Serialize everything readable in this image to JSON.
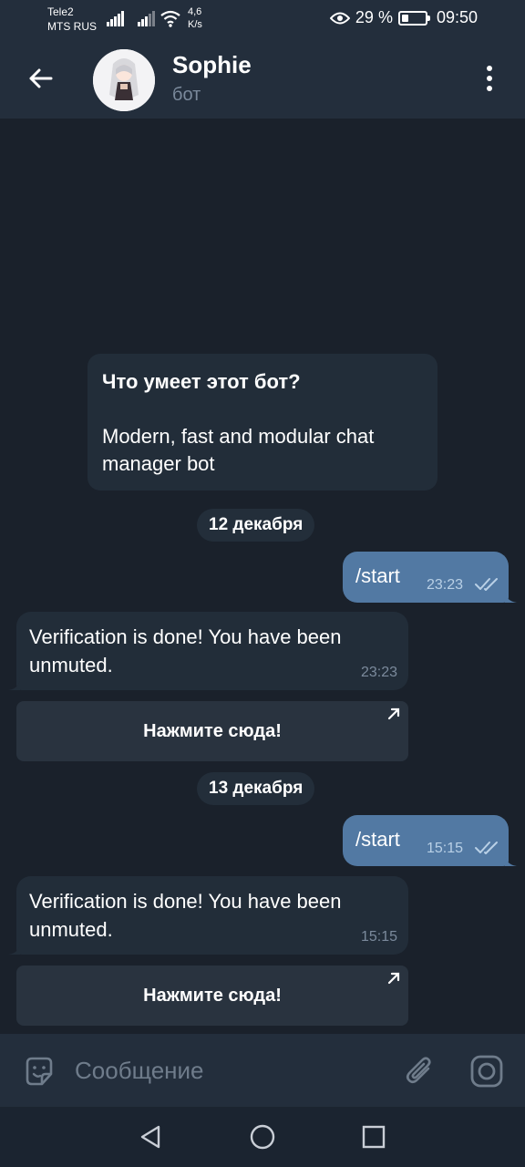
{
  "status_bar": {
    "carrier1": "Tele2",
    "carrier2": "MTS RUS",
    "net_speed_value": "4,6",
    "net_speed_unit": "K/s",
    "battery_percent": "29 %",
    "battery_level": 0.29,
    "time": "09:50",
    "icons": [
      "signal-icon",
      "signal-icon",
      "wifi-icon",
      "eye-icon",
      "battery-icon"
    ]
  },
  "header": {
    "title": "Sophie",
    "subtitle": "бот",
    "icons": [
      "back-arrow-icon",
      "more-vertical-icon"
    ]
  },
  "bot_info": {
    "title": "Что умеет этот бот?",
    "text": "Modern, fast and modular chat manager bot"
  },
  "messages": [
    {
      "type": "date",
      "text": "12 декабря"
    },
    {
      "type": "out",
      "text": "/start",
      "time": "23:23"
    },
    {
      "type": "in",
      "text": "Verification is done! You have been unmuted.",
      "time": "23:23"
    },
    {
      "type": "button",
      "text": "Нажмите сюда!"
    },
    {
      "type": "date",
      "text": "13 декабря"
    },
    {
      "type": "out",
      "text": "/start",
      "time": "15:15"
    },
    {
      "type": "in",
      "text": "Verification is done! You have been unmuted.",
      "time": "15:15"
    },
    {
      "type": "button",
      "text": "Нажмите сюда!"
    }
  ],
  "composer": {
    "placeholder": "Сообщение",
    "icons": [
      "sticker-icon",
      "attach-icon",
      "camera-icon"
    ]
  },
  "navbar": {
    "icons": [
      "nav-back-icon",
      "nav-home-icon",
      "nav-recents-icon"
    ]
  },
  "colors": {
    "background": "#1a212b",
    "header": "#232e3c",
    "incoming_bubble": "#222d39",
    "outgoing_bubble": "#5279a3",
    "muted_text": "#7b8a9c"
  }
}
